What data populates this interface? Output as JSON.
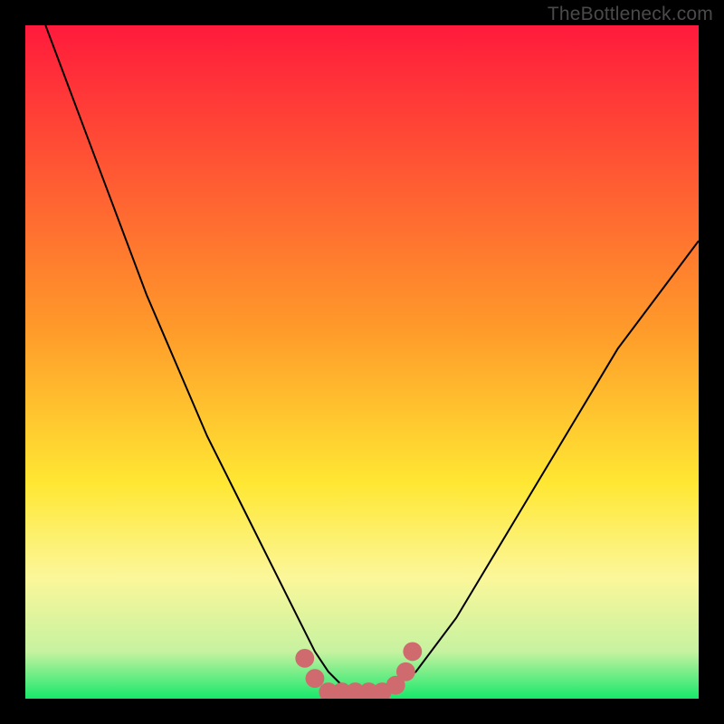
{
  "watermark": {
    "text": "TheBottleneck.com"
  },
  "colors": {
    "red": "#ff1a3c",
    "orange": "#ff8a2a",
    "yellow": "#ffe733",
    "pale_yellow": "#fbf79a",
    "pale_green": "#c7f2a0",
    "green": "#17e86b",
    "curve": "#000000",
    "dot": "#cf6a6e",
    "frame": "#000000"
  },
  "chart_data": {
    "type": "line",
    "title": "",
    "xlabel": "",
    "ylabel": "",
    "xlim": [
      0,
      100
    ],
    "ylim": [
      0,
      100
    ],
    "gradient_stops": [
      {
        "pct": 0,
        "color": "#ff1a3c"
      },
      {
        "pct": 45,
        "color": "#ff9a2a"
      },
      {
        "pct": 68,
        "color": "#ffe733"
      },
      {
        "pct": 82,
        "color": "#fbf79a"
      },
      {
        "pct": 93,
        "color": "#c7f2a0"
      },
      {
        "pct": 100,
        "color": "#17e86b"
      }
    ],
    "series": [
      {
        "name": "bottleneck-curve",
        "x": [
          3,
          6,
          9,
          12,
          15,
          18,
          21,
          24,
          27,
          30,
          33,
          36,
          39,
          41,
          43,
          45,
          47,
          49,
          51,
          53,
          55,
          58,
          61,
          64,
          67,
          70,
          73,
          76,
          79,
          82,
          85,
          88,
          91,
          94,
          97,
          100
        ],
        "y": [
          100,
          92,
          84,
          76,
          68,
          60,
          53,
          46,
          39,
          33,
          27,
          21,
          15,
          11,
          7,
          4,
          2,
          1,
          1,
          1,
          2,
          4,
          8,
          12,
          17,
          22,
          27,
          32,
          37,
          42,
          47,
          52,
          56,
          60,
          64,
          68
        ]
      }
    ],
    "dots": {
      "name": "highlighted-region",
      "x": [
        41.5,
        43,
        45,
        47,
        49,
        51,
        53,
        55,
        56.5,
        57.5
      ],
      "y": [
        6,
        3,
        1,
        1,
        1,
        1,
        1,
        2,
        4,
        7
      ],
      "radius": 1.4
    }
  }
}
